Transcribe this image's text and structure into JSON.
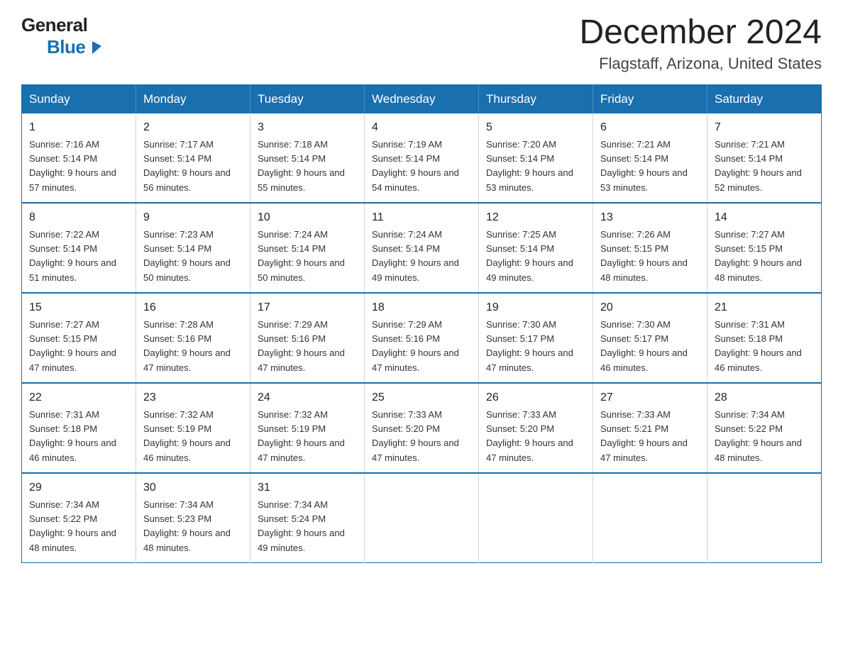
{
  "header": {
    "logo_line1": "General",
    "logo_line2": "Blue",
    "month_year": "December 2024",
    "location": "Flagstaff, Arizona, United States"
  },
  "days_of_week": [
    "Sunday",
    "Monday",
    "Tuesday",
    "Wednesday",
    "Thursday",
    "Friday",
    "Saturday"
  ],
  "weeks": [
    [
      {
        "day": "1",
        "sunrise": "7:16 AM",
        "sunset": "5:14 PM",
        "daylight": "9 hours and 57 minutes."
      },
      {
        "day": "2",
        "sunrise": "7:17 AM",
        "sunset": "5:14 PM",
        "daylight": "9 hours and 56 minutes."
      },
      {
        "day": "3",
        "sunrise": "7:18 AM",
        "sunset": "5:14 PM",
        "daylight": "9 hours and 55 minutes."
      },
      {
        "day": "4",
        "sunrise": "7:19 AM",
        "sunset": "5:14 PM",
        "daylight": "9 hours and 54 minutes."
      },
      {
        "day": "5",
        "sunrise": "7:20 AM",
        "sunset": "5:14 PM",
        "daylight": "9 hours and 53 minutes."
      },
      {
        "day": "6",
        "sunrise": "7:21 AM",
        "sunset": "5:14 PM",
        "daylight": "9 hours and 53 minutes."
      },
      {
        "day": "7",
        "sunrise": "7:21 AM",
        "sunset": "5:14 PM",
        "daylight": "9 hours and 52 minutes."
      }
    ],
    [
      {
        "day": "8",
        "sunrise": "7:22 AM",
        "sunset": "5:14 PM",
        "daylight": "9 hours and 51 minutes."
      },
      {
        "day": "9",
        "sunrise": "7:23 AM",
        "sunset": "5:14 PM",
        "daylight": "9 hours and 50 minutes."
      },
      {
        "day": "10",
        "sunrise": "7:24 AM",
        "sunset": "5:14 PM",
        "daylight": "9 hours and 50 minutes."
      },
      {
        "day": "11",
        "sunrise": "7:24 AM",
        "sunset": "5:14 PM",
        "daylight": "9 hours and 49 minutes."
      },
      {
        "day": "12",
        "sunrise": "7:25 AM",
        "sunset": "5:14 PM",
        "daylight": "9 hours and 49 minutes."
      },
      {
        "day": "13",
        "sunrise": "7:26 AM",
        "sunset": "5:15 PM",
        "daylight": "9 hours and 48 minutes."
      },
      {
        "day": "14",
        "sunrise": "7:27 AM",
        "sunset": "5:15 PM",
        "daylight": "9 hours and 48 minutes."
      }
    ],
    [
      {
        "day": "15",
        "sunrise": "7:27 AM",
        "sunset": "5:15 PM",
        "daylight": "9 hours and 47 minutes."
      },
      {
        "day": "16",
        "sunrise": "7:28 AM",
        "sunset": "5:16 PM",
        "daylight": "9 hours and 47 minutes."
      },
      {
        "day": "17",
        "sunrise": "7:29 AM",
        "sunset": "5:16 PM",
        "daylight": "9 hours and 47 minutes."
      },
      {
        "day": "18",
        "sunrise": "7:29 AM",
        "sunset": "5:16 PM",
        "daylight": "9 hours and 47 minutes."
      },
      {
        "day": "19",
        "sunrise": "7:30 AM",
        "sunset": "5:17 PM",
        "daylight": "9 hours and 47 minutes."
      },
      {
        "day": "20",
        "sunrise": "7:30 AM",
        "sunset": "5:17 PM",
        "daylight": "9 hours and 46 minutes."
      },
      {
        "day": "21",
        "sunrise": "7:31 AM",
        "sunset": "5:18 PM",
        "daylight": "9 hours and 46 minutes."
      }
    ],
    [
      {
        "day": "22",
        "sunrise": "7:31 AM",
        "sunset": "5:18 PM",
        "daylight": "9 hours and 46 minutes."
      },
      {
        "day": "23",
        "sunrise": "7:32 AM",
        "sunset": "5:19 PM",
        "daylight": "9 hours and 46 minutes."
      },
      {
        "day": "24",
        "sunrise": "7:32 AM",
        "sunset": "5:19 PM",
        "daylight": "9 hours and 47 minutes."
      },
      {
        "day": "25",
        "sunrise": "7:33 AM",
        "sunset": "5:20 PM",
        "daylight": "9 hours and 47 minutes."
      },
      {
        "day": "26",
        "sunrise": "7:33 AM",
        "sunset": "5:20 PM",
        "daylight": "9 hours and 47 minutes."
      },
      {
        "day": "27",
        "sunrise": "7:33 AM",
        "sunset": "5:21 PM",
        "daylight": "9 hours and 47 minutes."
      },
      {
        "day": "28",
        "sunrise": "7:34 AM",
        "sunset": "5:22 PM",
        "daylight": "9 hours and 48 minutes."
      }
    ],
    [
      {
        "day": "29",
        "sunrise": "7:34 AM",
        "sunset": "5:22 PM",
        "daylight": "9 hours and 48 minutes."
      },
      {
        "day": "30",
        "sunrise": "7:34 AM",
        "sunset": "5:23 PM",
        "daylight": "9 hours and 48 minutes."
      },
      {
        "day": "31",
        "sunrise": "7:34 AM",
        "sunset": "5:24 PM",
        "daylight": "9 hours and 49 minutes."
      },
      null,
      null,
      null,
      null
    ]
  ],
  "labels": {
    "sunrise_prefix": "Sunrise: ",
    "sunset_prefix": "Sunset: ",
    "daylight_prefix": "Daylight: "
  }
}
